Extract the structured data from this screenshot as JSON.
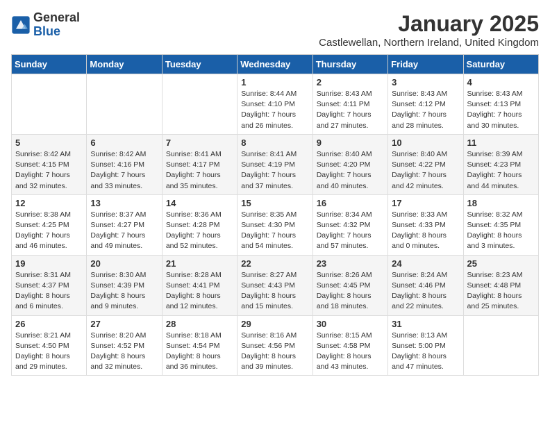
{
  "logo": {
    "general": "General",
    "blue": "Blue"
  },
  "title": "January 2025",
  "subtitle": "Castlewellan, Northern Ireland, United Kingdom",
  "days_of_week": [
    "Sunday",
    "Monday",
    "Tuesday",
    "Wednesday",
    "Thursday",
    "Friday",
    "Saturday"
  ],
  "weeks": [
    [
      {
        "num": "",
        "info": ""
      },
      {
        "num": "",
        "info": ""
      },
      {
        "num": "",
        "info": ""
      },
      {
        "num": "1",
        "info": "Sunrise: 8:44 AM\nSunset: 4:10 PM\nDaylight: 7 hours and 26 minutes."
      },
      {
        "num": "2",
        "info": "Sunrise: 8:43 AM\nSunset: 4:11 PM\nDaylight: 7 hours and 27 minutes."
      },
      {
        "num": "3",
        "info": "Sunrise: 8:43 AM\nSunset: 4:12 PM\nDaylight: 7 hours and 28 minutes."
      },
      {
        "num": "4",
        "info": "Sunrise: 8:43 AM\nSunset: 4:13 PM\nDaylight: 7 hours and 30 minutes."
      }
    ],
    [
      {
        "num": "5",
        "info": "Sunrise: 8:42 AM\nSunset: 4:15 PM\nDaylight: 7 hours and 32 minutes."
      },
      {
        "num": "6",
        "info": "Sunrise: 8:42 AM\nSunset: 4:16 PM\nDaylight: 7 hours and 33 minutes."
      },
      {
        "num": "7",
        "info": "Sunrise: 8:41 AM\nSunset: 4:17 PM\nDaylight: 7 hours and 35 minutes."
      },
      {
        "num": "8",
        "info": "Sunrise: 8:41 AM\nSunset: 4:19 PM\nDaylight: 7 hours and 37 minutes."
      },
      {
        "num": "9",
        "info": "Sunrise: 8:40 AM\nSunset: 4:20 PM\nDaylight: 7 hours and 40 minutes."
      },
      {
        "num": "10",
        "info": "Sunrise: 8:40 AM\nSunset: 4:22 PM\nDaylight: 7 hours and 42 minutes."
      },
      {
        "num": "11",
        "info": "Sunrise: 8:39 AM\nSunset: 4:23 PM\nDaylight: 7 hours and 44 minutes."
      }
    ],
    [
      {
        "num": "12",
        "info": "Sunrise: 8:38 AM\nSunset: 4:25 PM\nDaylight: 7 hours and 46 minutes."
      },
      {
        "num": "13",
        "info": "Sunrise: 8:37 AM\nSunset: 4:27 PM\nDaylight: 7 hours and 49 minutes."
      },
      {
        "num": "14",
        "info": "Sunrise: 8:36 AM\nSunset: 4:28 PM\nDaylight: 7 hours and 52 minutes."
      },
      {
        "num": "15",
        "info": "Sunrise: 8:35 AM\nSunset: 4:30 PM\nDaylight: 7 hours and 54 minutes."
      },
      {
        "num": "16",
        "info": "Sunrise: 8:34 AM\nSunset: 4:32 PM\nDaylight: 7 hours and 57 minutes."
      },
      {
        "num": "17",
        "info": "Sunrise: 8:33 AM\nSunset: 4:33 PM\nDaylight: 8 hours and 0 minutes."
      },
      {
        "num": "18",
        "info": "Sunrise: 8:32 AM\nSunset: 4:35 PM\nDaylight: 8 hours and 3 minutes."
      }
    ],
    [
      {
        "num": "19",
        "info": "Sunrise: 8:31 AM\nSunset: 4:37 PM\nDaylight: 8 hours and 6 minutes."
      },
      {
        "num": "20",
        "info": "Sunrise: 8:30 AM\nSunset: 4:39 PM\nDaylight: 8 hours and 9 minutes."
      },
      {
        "num": "21",
        "info": "Sunrise: 8:28 AM\nSunset: 4:41 PM\nDaylight: 8 hours and 12 minutes."
      },
      {
        "num": "22",
        "info": "Sunrise: 8:27 AM\nSunset: 4:43 PM\nDaylight: 8 hours and 15 minutes."
      },
      {
        "num": "23",
        "info": "Sunrise: 8:26 AM\nSunset: 4:45 PM\nDaylight: 8 hours and 18 minutes."
      },
      {
        "num": "24",
        "info": "Sunrise: 8:24 AM\nSunset: 4:46 PM\nDaylight: 8 hours and 22 minutes."
      },
      {
        "num": "25",
        "info": "Sunrise: 8:23 AM\nSunset: 4:48 PM\nDaylight: 8 hours and 25 minutes."
      }
    ],
    [
      {
        "num": "26",
        "info": "Sunrise: 8:21 AM\nSunset: 4:50 PM\nDaylight: 8 hours and 29 minutes."
      },
      {
        "num": "27",
        "info": "Sunrise: 8:20 AM\nSunset: 4:52 PM\nDaylight: 8 hours and 32 minutes."
      },
      {
        "num": "28",
        "info": "Sunrise: 8:18 AM\nSunset: 4:54 PM\nDaylight: 8 hours and 36 minutes."
      },
      {
        "num": "29",
        "info": "Sunrise: 8:16 AM\nSunset: 4:56 PM\nDaylight: 8 hours and 39 minutes."
      },
      {
        "num": "30",
        "info": "Sunrise: 8:15 AM\nSunset: 4:58 PM\nDaylight: 8 hours and 43 minutes."
      },
      {
        "num": "31",
        "info": "Sunrise: 8:13 AM\nSunset: 5:00 PM\nDaylight: 8 hours and 47 minutes."
      },
      {
        "num": "",
        "info": ""
      }
    ]
  ]
}
